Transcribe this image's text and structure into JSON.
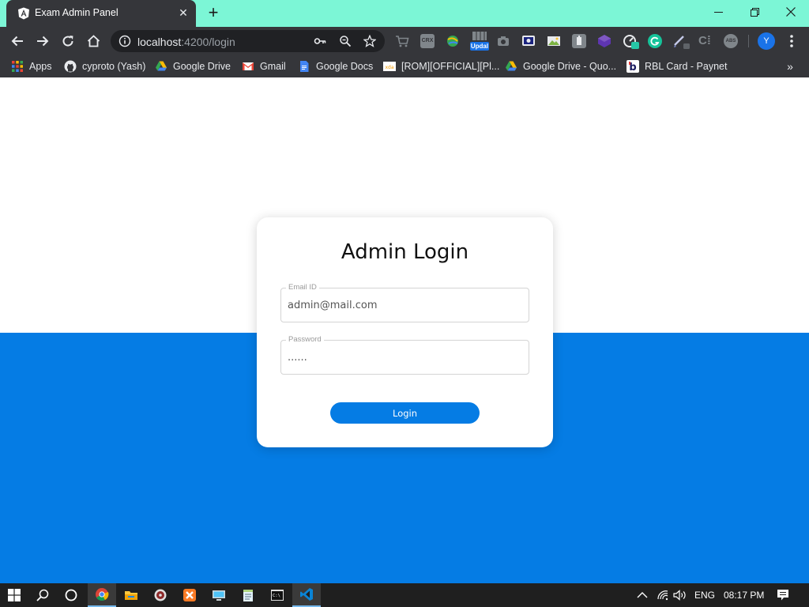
{
  "browser": {
    "tab": {
      "title": "Exam Admin Panel",
      "favicon_icon": "angular-icon"
    },
    "address": {
      "host": "localhost",
      "path": ":4200/login"
    },
    "profile_initial": "Y",
    "extension_badge": "Updal",
    "window_controls": [
      "minimize-icon",
      "restore-icon",
      "close-icon"
    ]
  },
  "bookmarks": [
    {
      "label": "Apps",
      "icon": "apps-grid-icon"
    },
    {
      "label": "cyproto (Yash)",
      "icon": "github-icon"
    },
    {
      "label": "Google Drive",
      "icon": "google-drive-icon"
    },
    {
      "label": "Gmail",
      "icon": "gmail-icon"
    },
    {
      "label": "Google Docs",
      "icon": "google-docs-icon"
    },
    {
      "label": "[ROM][OFFICIAL][Pl...",
      "icon": "xda-icon"
    },
    {
      "label": "Google Drive - Quo...",
      "icon": "google-drive-icon"
    },
    {
      "label": "RBL Card - Paynet",
      "icon": "rbl-bank-icon"
    }
  ],
  "login": {
    "title": "Admin Login",
    "email_label": "Email ID",
    "email_value": "admin@mail.com",
    "password_label": "Password",
    "password_display": "......",
    "button_label": "Login"
  },
  "colors": {
    "accent": "#057ce4",
    "titlebar": "#7cf6d6",
    "chrome_dark": "#35363a"
  },
  "taskbar": {
    "apps": [
      "windows-start-icon",
      "search-icon",
      "cortana-icon",
      "chrome-icon",
      "file-explorer-icon",
      "media-player-icon",
      "xampp-icon",
      "remote-desktop-icon",
      "notepad-icon",
      "command-prompt-icon",
      "vscode-icon"
    ],
    "language": "ENG",
    "time": "08:17 PM"
  }
}
